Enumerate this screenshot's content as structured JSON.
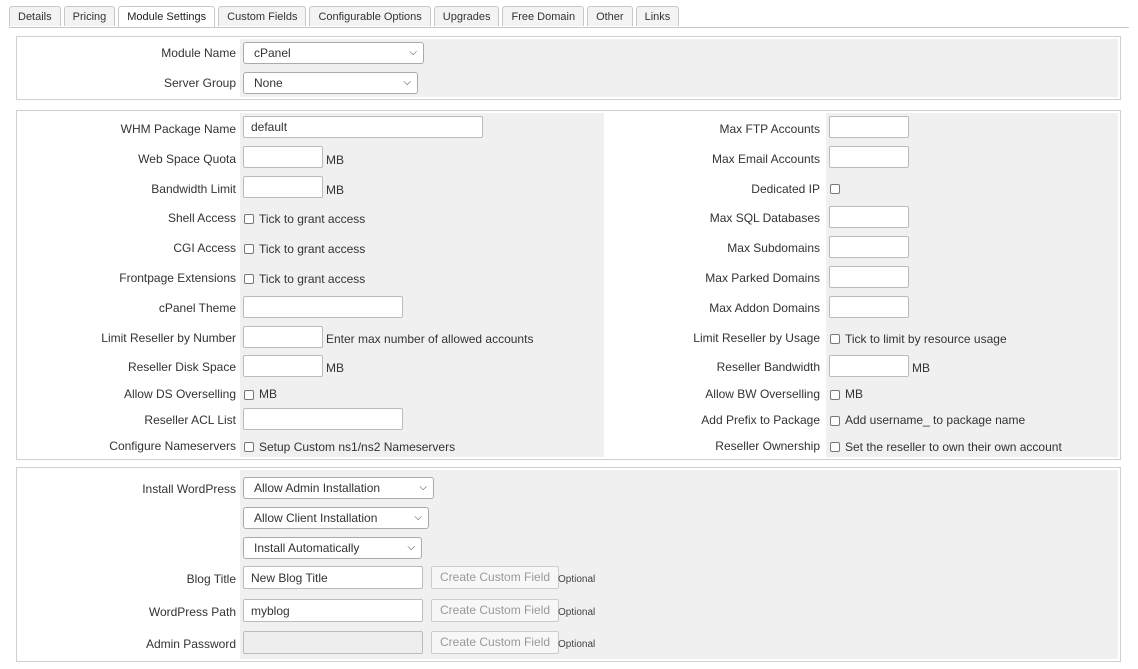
{
  "tabs": [
    "Details",
    "Pricing",
    "Module Settings",
    "Custom Fields",
    "Configurable Options",
    "Upgrades",
    "Free Domain",
    "Other",
    "Links"
  ],
  "active_tab": "Module Settings",
  "module": {
    "module_name_label": "Module Name",
    "module_name_value": "cPanel",
    "server_group_label": "Server Group",
    "server_group_value": "None"
  },
  "config": {
    "whm_package_label": "WHM Package Name",
    "whm_package_value": "default",
    "web_space_label": "Web Space Quota",
    "bandwidth_label": "Bandwidth Limit",
    "unit_mb": "MB",
    "shell_label": "Shell Access",
    "cgi_label": "CGI Access",
    "frontpage_label": "Frontpage Extensions",
    "grant_text": "Tick to grant access",
    "theme_label": "cPanel Theme",
    "limit_num_label": "Limit Reseller by Number",
    "limit_num_hint": "Enter max number of allowed accounts",
    "disk_label": "Reseller Disk Space",
    "ds_over_label": "Allow DS Overselling",
    "acl_label": "Reseller ACL List",
    "ns_label": "Configure Nameservers",
    "ns_text": "Setup Custom ns1/ns2 Nameservers",
    "ftp_label": "Max FTP Accounts",
    "email_label": "Max Email Accounts",
    "ip_label": "Dedicated IP",
    "sql_label": "Max SQL Databases",
    "sub_label": "Max Subdomains",
    "parked_label": "Max Parked Domains",
    "addon_label": "Max Addon Domains",
    "limit_usage_label": "Limit Reseller by Usage",
    "limit_usage_text": "Tick to limit by resource usage",
    "bw_label": "Reseller Bandwidth",
    "bw_over_label": "Allow BW Overselling",
    "prefix_label": "Add Prefix to Package",
    "prefix_text": "Add username_ to package name",
    "owner_label": "Reseller Ownership",
    "owner_text": "Set the reseller to own their own account"
  },
  "wordpress": {
    "install_label": "Install WordPress",
    "admin_install": "Allow Admin Installation",
    "client_install": "Allow Client Installation",
    "auto_install": "Install Automatically",
    "blog_title_label": "Blog Title",
    "blog_title_value": "New Blog Title",
    "path_label": "WordPress Path",
    "path_value": "myblog",
    "password_label": "Admin Password",
    "create_field_btn": "Create Custom Field",
    "optional": "Optional"
  }
}
